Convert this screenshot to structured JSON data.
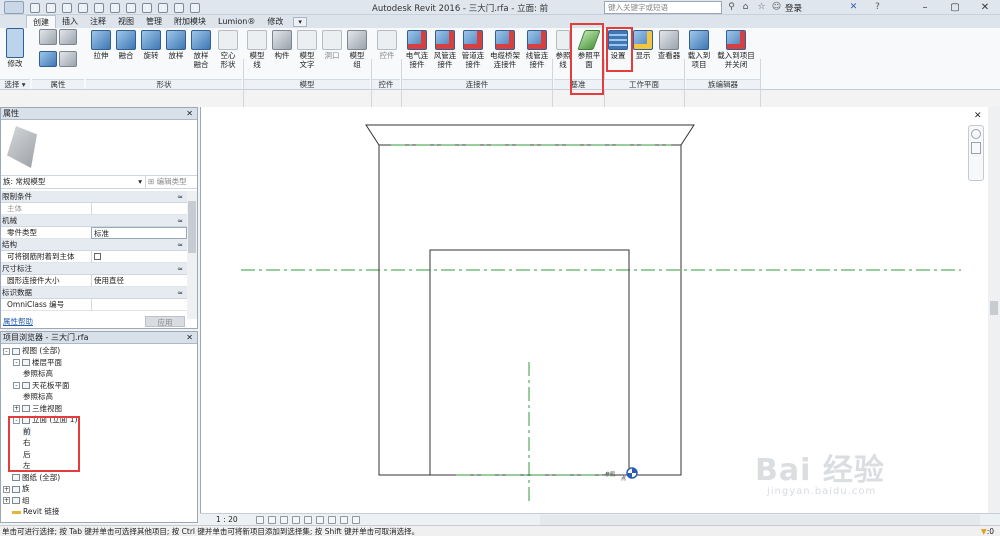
{
  "titlebar": {
    "app_title": "Autodesk Revit 2016 -     三大门.rfa - 立面: 前",
    "search_placeholder": "键入关键字或短语",
    "login_label": "登录"
  },
  "tabs": [
    "创建",
    "插入",
    "注释",
    "视图",
    "管理",
    "附加模块",
    "Lumion®",
    "修改"
  ],
  "active_tab": "创建",
  "ribbon": {
    "buttons": {
      "modify": "修改",
      "extrude": "拉伸",
      "blend": "融合",
      "revolve": "旋转",
      "sweep": "放样",
      "sweep_blend": "放样融合",
      "void": "空心形状",
      "model_line": "模型线",
      "component": "构件",
      "model_text": "模型文字",
      "opening": "洞口",
      "model_group": "模型组",
      "control": "控件",
      "elec": "电气连接件",
      "duct": "风管连接件",
      "pipe": "管道连接件",
      "cable_tray": "电缆桥架连接件",
      "conduit": "线管连接件",
      "ref_line": "参照线",
      "ref_plane": "参照平面",
      "set": "设置",
      "show": "显示",
      "viewer": "查看器",
      "load": "载入到项目",
      "load_close": "载入到项目并关闭"
    },
    "panels": {
      "select": "选择",
      "properties": "属性",
      "forms": "形状",
      "model": "模型",
      "control": "控件",
      "connectors": "连接件",
      "datum": "基准",
      "work_plane": "工作平面",
      "family_editor": "族编辑器"
    }
  },
  "properties": {
    "title": "属性",
    "family_type": "族: 常规模型",
    "edit_type": "编辑类型",
    "categories": [
      {
        "name": "限制条件",
        "rows": [
          {
            "k": "主体",
            "v": "",
            "dim": true
          }
        ]
      },
      {
        "name": "机械",
        "rows": [
          {
            "k": "零件类型",
            "v": "标准",
            "boxed": true
          }
        ]
      },
      {
        "name": "结构",
        "rows": [
          {
            "k": "可将钢筋附着到主体",
            "v": "",
            "check": true
          }
        ]
      },
      {
        "name": "尺寸标注",
        "rows": [
          {
            "k": "圆形连接件大小",
            "v": "使用直径"
          }
        ]
      },
      {
        "name": "标识数据",
        "rows": [
          {
            "k": "OmniClass 编号",
            "v": ""
          }
        ]
      }
    ],
    "help_link": "属性帮助",
    "apply": "应用"
  },
  "project_browser": {
    "title": "项目浏览器 - 三大门.rfa",
    "nodes": [
      {
        "label": "视图 (全部)",
        "level": 0,
        "exp": "-"
      },
      {
        "label": "楼层平面",
        "level": 1,
        "exp": "-"
      },
      {
        "label": "参照标高",
        "level": 2
      },
      {
        "label": "天花板平面",
        "level": 1,
        "exp": "-"
      },
      {
        "label": "参照标高",
        "level": 2
      },
      {
        "label": "三维视图",
        "level": 1,
        "exp": "+"
      },
      {
        "label": "立面 (立面 1)",
        "level": 1,
        "exp": "-"
      },
      {
        "label": "前",
        "level": 2,
        "selected": true
      },
      {
        "label": "右",
        "level": 2
      },
      {
        "label": "后",
        "level": 2
      },
      {
        "label": "左",
        "level": 2
      },
      {
        "label": "图纸 (全部)",
        "level": 0,
        "icon": "sheet"
      },
      {
        "label": "族",
        "level": 0,
        "exp": "+",
        "icon": "fam"
      },
      {
        "label": "组",
        "level": 0,
        "exp": "+",
        "icon": "grp"
      },
      {
        "label": "Revit 链接",
        "level": 0,
        "icon": "rev"
      }
    ]
  },
  "viewbar": {
    "scale": "1 : 20"
  },
  "canvas": {
    "point_labels": [
      "参照",
      "点"
    ]
  },
  "status": {
    "text": "单击可进行选择; 按 Tab 键并单击可选择其他项目; 按 Ctrl 键并单击可将新项目添加到选择集; 按 Shift 键并单击可取消选择。",
    "right": ":0"
  },
  "watermark": {
    "main": "Bai 经验",
    "sub": "jingyan.baidu.com"
  },
  "colors": {
    "accent": "#3f78b4",
    "highlight_box": "#e43b3b",
    "ref_line": "#2e9c3a"
  }
}
